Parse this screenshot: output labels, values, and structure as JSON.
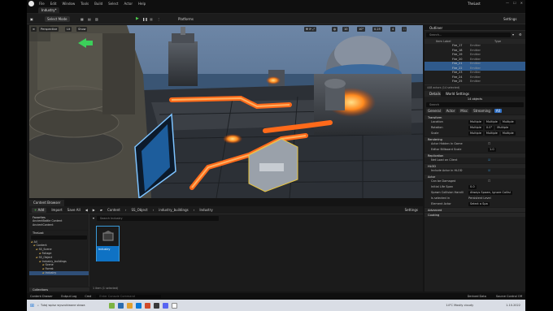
{
  "menubar": {
    "items": [
      "File",
      "Edit",
      "Window",
      "Tools",
      "Build",
      "Select",
      "Actor",
      "Help"
    ],
    "window_title": "TheLost"
  },
  "level_tab": "Industry*",
  "toolbar": {
    "mode": "Select Mode",
    "platforms": "Platforms",
    "settings": "Settings"
  },
  "viewport": {
    "perspective": "Perspective",
    "lit": "Lit",
    "show": "Show",
    "snap_grid": "10",
    "snap_angle": "10°",
    "snap_scale": "0.25",
    "camera_speed": "4"
  },
  "outliner": {
    "title": "Outliner",
    "search_placeholder": "Search...",
    "col_item": "Item Label",
    "col_type": "Type",
    "rows": [
      {
        "name": "Fire_17",
        "type": "Emitter",
        "selected": false
      },
      {
        "name": "Fire_18",
        "type": "Emitter",
        "selected": false
      },
      {
        "name": "Fire_19",
        "type": "Emitter",
        "selected": false
      },
      {
        "name": "Fire_20",
        "type": "Emitter",
        "selected": false
      },
      {
        "name": "Fire_21",
        "type": "Emitter",
        "selected": true
      },
      {
        "name": "Fire_22",
        "type": "Emitter",
        "selected": true
      },
      {
        "name": "Fire_23",
        "type": "Emitter",
        "selected": false
      },
      {
        "name": "Fire_24",
        "type": "Emitter",
        "selected": false
      },
      {
        "name": "Fire_25",
        "type": "Emitter",
        "selected": false
      }
    ],
    "footer": "448 actors (14 selected)"
  },
  "details": {
    "tab1": "Details",
    "tab2": "World Settings",
    "objects": "14 objects",
    "search_placeholder": "Search",
    "filters": [
      "General",
      "Actor",
      "Misc",
      "Streaming",
      "All"
    ],
    "sections": {
      "transform": "Transform",
      "rendering": "Rendering",
      "replication": "Replication",
      "hlod": "HLOD",
      "actor": "Actor",
      "advanced": "Advanced",
      "cooking": "Cooking"
    },
    "location": "Location",
    "rotation": "Rotation",
    "scale": "Scale",
    "multiple": "Multiple",
    "rot_val": "0.0°",
    "actor_hidden": "Actor Hidden In Game",
    "editor_billboard": "Editor Billboard Scale",
    "billboard_val": "1.0",
    "net_load": "Net Load on Client",
    "include_hlod": "Include Actor in HLOD",
    "can_be_damaged": "Can be Damaged",
    "initial_life_span": "Initial Life Span",
    "life_val": "0.0",
    "spawn_collision": "Spawn Collision Handli",
    "spawn_val": "Always Spawn, Ignore Collisi",
    "is_selected": "Is selected in",
    "persistent": "Persistent Level",
    "element_actor": "Element Actor",
    "select_spawn": "Select a Spa"
  },
  "content_browser": {
    "tab": "Content Browser",
    "add": "Add",
    "import": "Import",
    "save_all": "Save All",
    "breadcrumbs": [
      "Content",
      "SS_Object",
      "industry_buildings",
      "Industry"
    ],
    "settings": "Settings",
    "search_placeholder": "Search Industry",
    "favorites": "Favorites",
    "fav_items": [
      "AncientBattle Content",
      "AncientContent"
    ],
    "project": "TheLost",
    "tree": [
      {
        "label": "All",
        "selected": false
      },
      {
        "label": "Content",
        "selected": false
      },
      {
        "label": "SS_Scene",
        "selected": false
      },
      {
        "label": "Foliage",
        "selected": false
      },
      {
        "label": "SS_Object",
        "selected": false
      },
      {
        "label": "Industry_buildings",
        "selected": false
      },
      {
        "label": "Scene",
        "selected": false
      },
      {
        "label": "Forest",
        "selected": false
      },
      {
        "label": "Industry",
        "selected": true
      }
    ],
    "collections": "Collections",
    "asset_label": "Industry",
    "status": "1 item (1 selected)"
  },
  "statusbar": {
    "content_drawer": "Content Drawer",
    "output_log": "Output Log",
    "cmd": "Cmd",
    "console_placeholder": "Enter Console Command",
    "derived": "Derived Data",
    "source": "Source Control Off"
  },
  "taskbar": {
    "search_placeholder": "Tutaj wpisz wyszukiwane słowa",
    "weather": "14°C  Mostly cloudy",
    "date": "1.10.2022"
  }
}
